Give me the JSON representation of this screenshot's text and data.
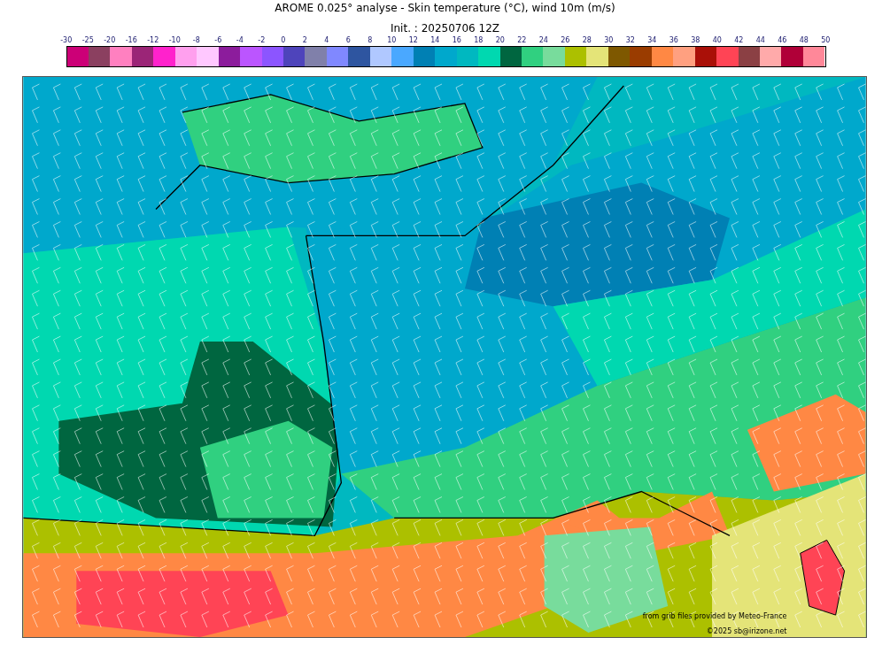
{
  "title": "AROME 0.025° analyse - Skin temperature (°C), wind 10m (m/s)",
  "subtitle": "Init. : 20250706 12Z",
  "legend": {
    "ticks": [
      "-30",
      "-25",
      "-20",
      "-16",
      "-12",
      "-10",
      "-8",
      "-6",
      "-4",
      "-2",
      "0",
      "2",
      "4",
      "6",
      "8",
      "10",
      "12",
      "14",
      "16",
      "18",
      "20",
      "22",
      "24",
      "26",
      "28",
      "30",
      "32",
      "34",
      "36",
      "38",
      "40",
      "42",
      "44",
      "46",
      "48",
      "50"
    ],
    "swatches": [
      {
        "color": "#cc0077"
      },
      {
        "color": "#8b4060"
      },
      {
        "color": "#ff80c0"
      },
      {
        "color": "#9b2577"
      },
      {
        "color": "#ff22cc"
      },
      {
        "color": "#ffa0ee"
      },
      {
        "color": "#ffc8ff"
      },
      {
        "color": "#8c1c9c"
      },
      {
        "color": "#bb55ff"
      },
      {
        "color": "#8c55ff"
      },
      {
        "color": "#4e44bb"
      },
      {
        "color": "#8080aa"
      },
      {
        "color": "#8088ff"
      },
      {
        "color": "#2e55a0"
      },
      {
        "color": "#b0c8ff"
      },
      {
        "color": "#4aa8ff"
      },
      {
        "color": "#0080b4"
      },
      {
        "color": "#00a8cc"
      },
      {
        "color": "#00b8c0"
      },
      {
        "color": "#00d8b0"
      },
      {
        "color": "#006640"
      },
      {
        "color": "#30d080"
      },
      {
        "color": "#78dc9c"
      },
      {
        "color": "#acc000"
      },
      {
        "color": "#e4e478"
      },
      {
        "color": "#7e5800"
      },
      {
        "color": "#9a3c00"
      },
      {
        "color": "#ff8844"
      },
      {
        "color": "#ffa080"
      },
      {
        "color": "#aa1008"
      },
      {
        "color": "#ff4455"
      },
      {
        "color": "#8b4044"
      },
      {
        "color": "#ffaaaa"
      },
      {
        "color": "#b00038"
      },
      {
        "color": "#ff8899"
      }
    ]
  },
  "credits": [
    "from grib files provided by Meteo-France",
    "©2025 sb@irizone.net"
  ]
}
